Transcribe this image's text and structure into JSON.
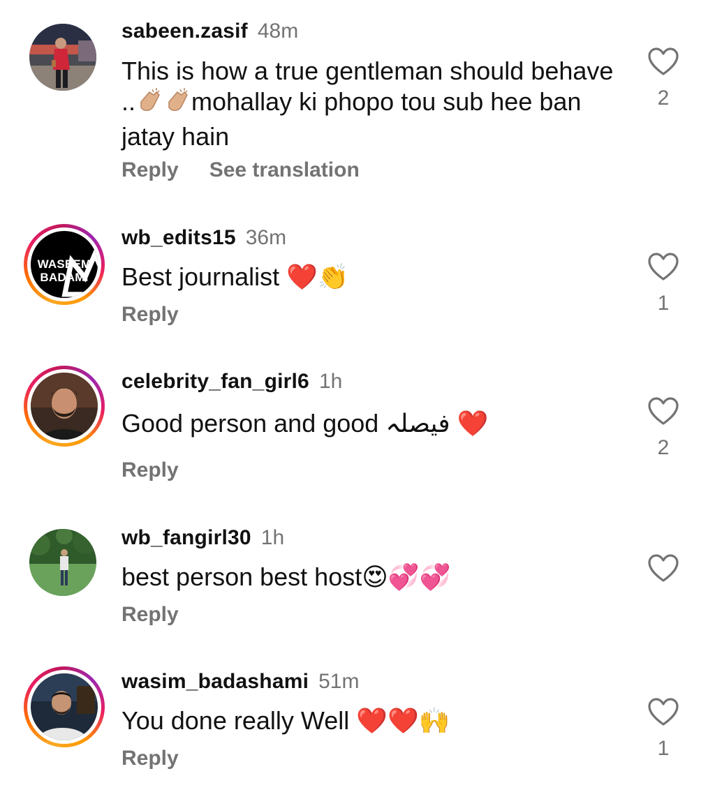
{
  "comments": [
    {
      "username": "sabeen.zasif",
      "time": "48m",
      "text": "This is how a true gentleman should behave ..👏🏼👏🏼mohallay ki phopo tou sub hee ban jatay hain",
      "reply_label": "Reply",
      "translate_label": "See translation",
      "likes": "2",
      "avatar": "woman-in-red-photo"
    },
    {
      "username": "wb_edits15",
      "time": "36m",
      "text": "Best journalist ❤️👏",
      "reply_label": "Reply",
      "likes": "1",
      "avatar": "waseem-badami-logo",
      "avatar_text": [
        "WASEEM",
        "BADAMI"
      ]
    },
    {
      "username": "celebrity_fan_girl6",
      "time": "1h",
      "text": "Good person and good فیصلہ ❤️",
      "reply_label": "Reply",
      "likes": "2",
      "avatar": "man-portrait-photo"
    },
    {
      "username": "wb_fangirl30",
      "time": "1h",
      "text": "best person best host😍💞💞",
      "reply_label": "Reply",
      "likes": "",
      "avatar": "park-photo"
    },
    {
      "username": "wasim_badashami",
      "time": "51m",
      "text": "You done really Well ❤️❤️🙌",
      "reply_label": "Reply",
      "likes": "1",
      "avatar": "man-selfie-photo"
    }
  ]
}
